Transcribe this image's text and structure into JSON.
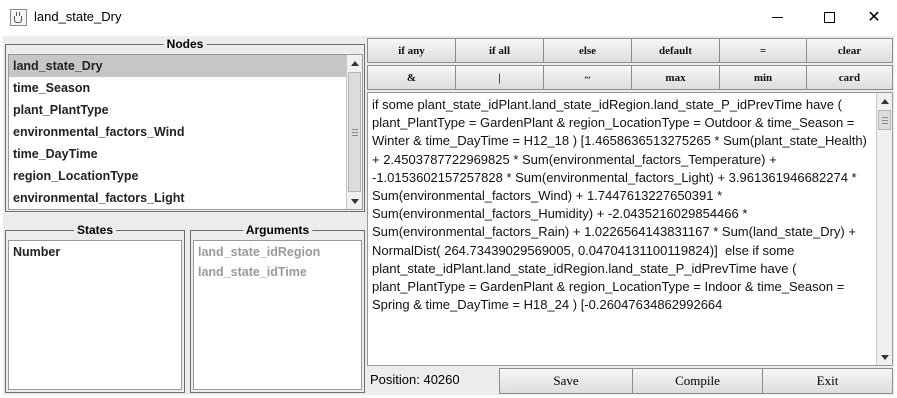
{
  "window": {
    "title": "land_state_Dry",
    "icon": "java-cup-icon",
    "close_glyph": "✕"
  },
  "nodes": {
    "title": "Nodes",
    "items": [
      "land_state_Dry",
      "time_Season",
      "plant_PlantType",
      "environmental_factors_Wind",
      "time_DayTime",
      "region_LocationType",
      "environmental_factors_Light"
    ],
    "selected": "land_state_Dry"
  },
  "states": {
    "title": "States",
    "items": [
      "Number"
    ]
  },
  "arguments": {
    "title": "Arguments",
    "items": [
      "land_state_idRegion",
      "land_state_idTime"
    ]
  },
  "operators": {
    "row1": [
      "if any",
      "if all",
      "else",
      "default",
      "=",
      "clear"
    ],
    "row2": [
      "&",
      "|",
      "~",
      "max",
      "min",
      "card"
    ]
  },
  "editor": {
    "text": "if some plant_state_idPlant.land_state_idRegion.land_state_P_idPrevTime have ( plant_PlantType = GardenPlant & region_LocationType = Outdoor & time_Season = Winter & time_DayTime = H12_18 ) [1.4658636513275265 * Sum(plant_state_Health) + 2.4503787722969825 * Sum(environmental_factors_Temperature) + -1.0153602157257828 * Sum(environmental_factors_Light) + 3.961361946682274 * Sum(environmental_factors_Wind) + 1.7447613227650391 * Sum(environmental_factors_Humidity) + -2.0435216029854466 * Sum(environmental_factors_Rain) + 1.0226564143831167 * Sum(land_state_Dry) + NormalDist( 264.73439029569005, 0.04704131100119824)]  else if some plant_state_idPlant.land_state_idRegion.land_state_P_idPrevTime have ( plant_PlantType = GardenPlant & region_LocationType = Indoor & time_Season = Spring & time_DayTime = H18_24 ) [-0.26047634862992664"
  },
  "footer": {
    "position_label": "Position: 40260",
    "save_label": "Save",
    "compile_label": "Compile",
    "exit_label": "Exit"
  }
}
